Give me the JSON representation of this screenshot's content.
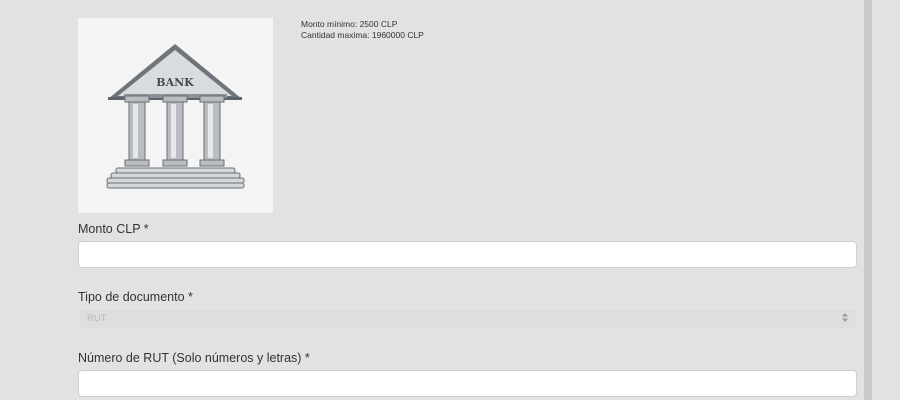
{
  "image": {
    "sign_text": "BANK",
    "icon": "bank-icon"
  },
  "limits": {
    "min_text": "Monto mínimo: 2500 CLP",
    "max_text": "Cantidad maxima: 1960000 CLP"
  },
  "form": {
    "amount": {
      "label": "Monto CLP *",
      "value": ""
    },
    "doc_type": {
      "label": "Tipo de documento *",
      "selected": "RUT",
      "icon": "select-arrows-icon"
    },
    "rut": {
      "label": "Número de RUT (Solo números y letras) *",
      "value": ""
    }
  }
}
